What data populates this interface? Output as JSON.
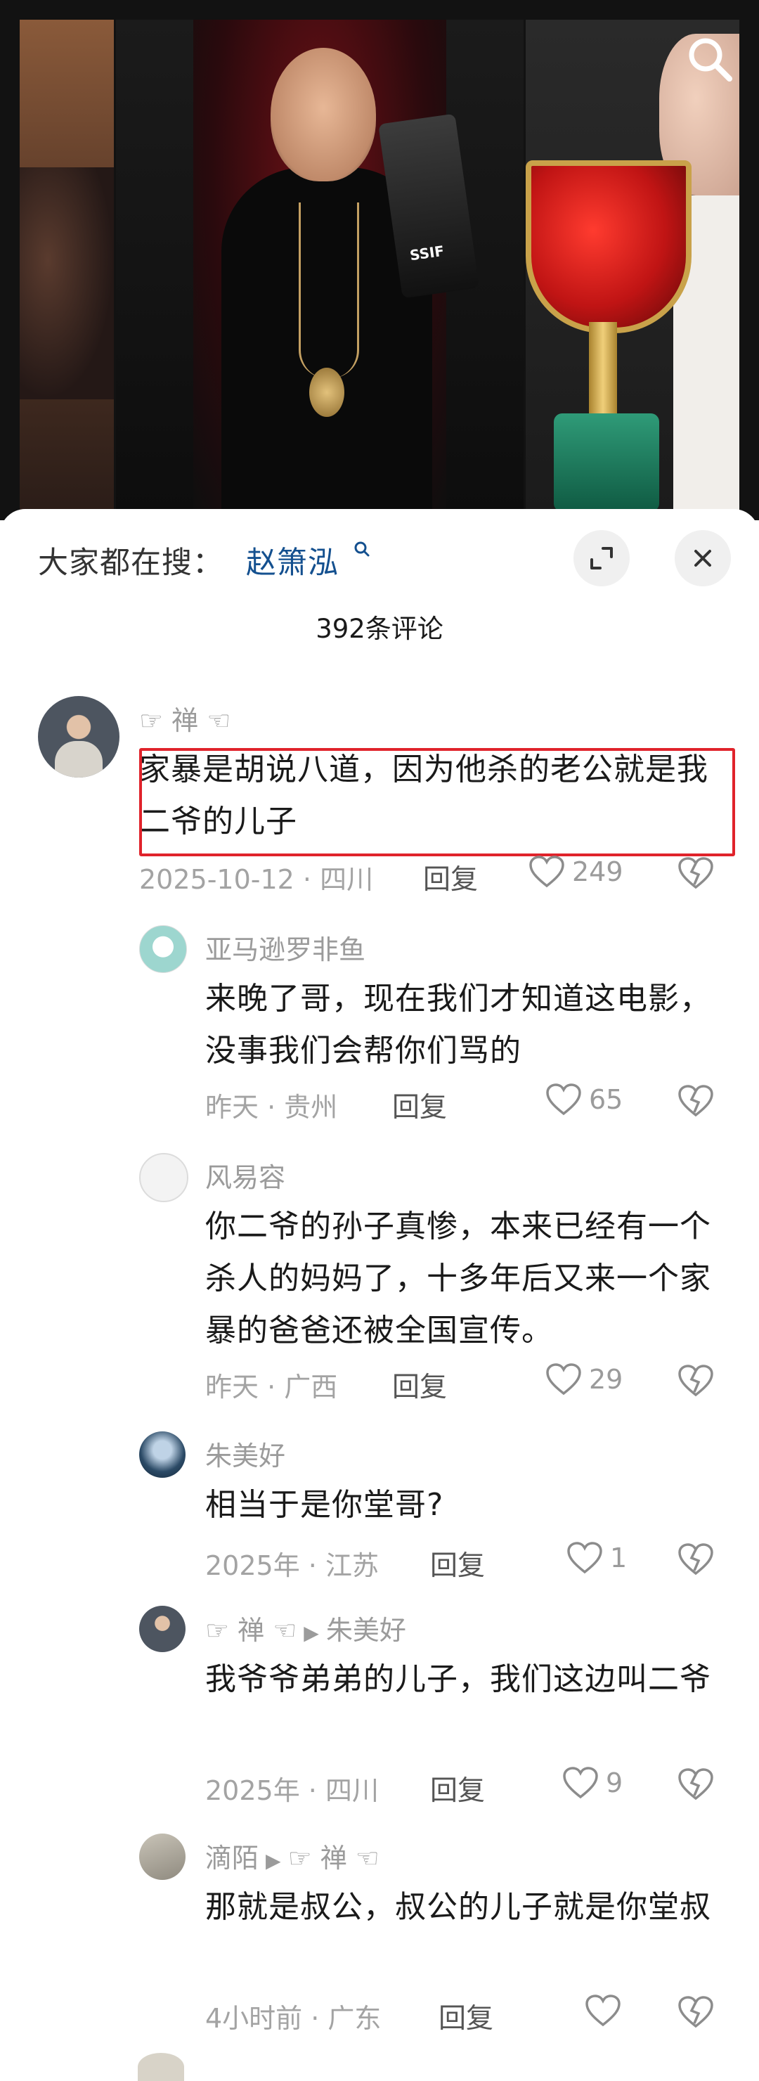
{
  "trending": {
    "prefix": "大家都在搜：",
    "keyword": "赵箫泓"
  },
  "comment_count": "392条评论",
  "hero": {
    "trophy_label": "SSIF"
  },
  "comments": [
    {
      "user": "☞ 禅 ☜",
      "text": "家暴是胡说八道，因为他杀的老公就是我二爷的儿子",
      "meta": "2025-10-12 · 四川",
      "reply": "回复",
      "likes": "249"
    },
    {
      "user": "亚马逊罗非鱼",
      "text": "来晚了哥，现在我们才知道这电影，没事我们会帮你们骂的",
      "meta": "昨天 · 贵州",
      "reply": "回复",
      "likes": "65"
    },
    {
      "user": "风易容",
      "text": "你二爷的孙子真惨，本来已经有一个杀人的妈妈了，十多年后又来一个家暴的爸爸还被全国宣传。",
      "meta": "昨天 · 广西",
      "reply": "回复",
      "likes": "29"
    },
    {
      "user": "朱美好",
      "text": "相当于是你堂哥?",
      "meta": "2025年 · 江苏",
      "reply": "回复",
      "likes": "1"
    },
    {
      "user": "☞ 禅 ☜",
      "reply_to": "朱美好",
      "text": "我爷爷弟弟的儿子，我们这边叫二爷",
      "meta": "2025年 · 四川",
      "reply": "回复",
      "likes": "9"
    },
    {
      "user": "滴陌",
      "reply_to": "☞ 禅 ☜",
      "text": "那就是叔公，叔公的儿子就是你堂叔",
      "meta": "4小时前 · 广东",
      "reply": "回复",
      "likes": ""
    }
  ]
}
